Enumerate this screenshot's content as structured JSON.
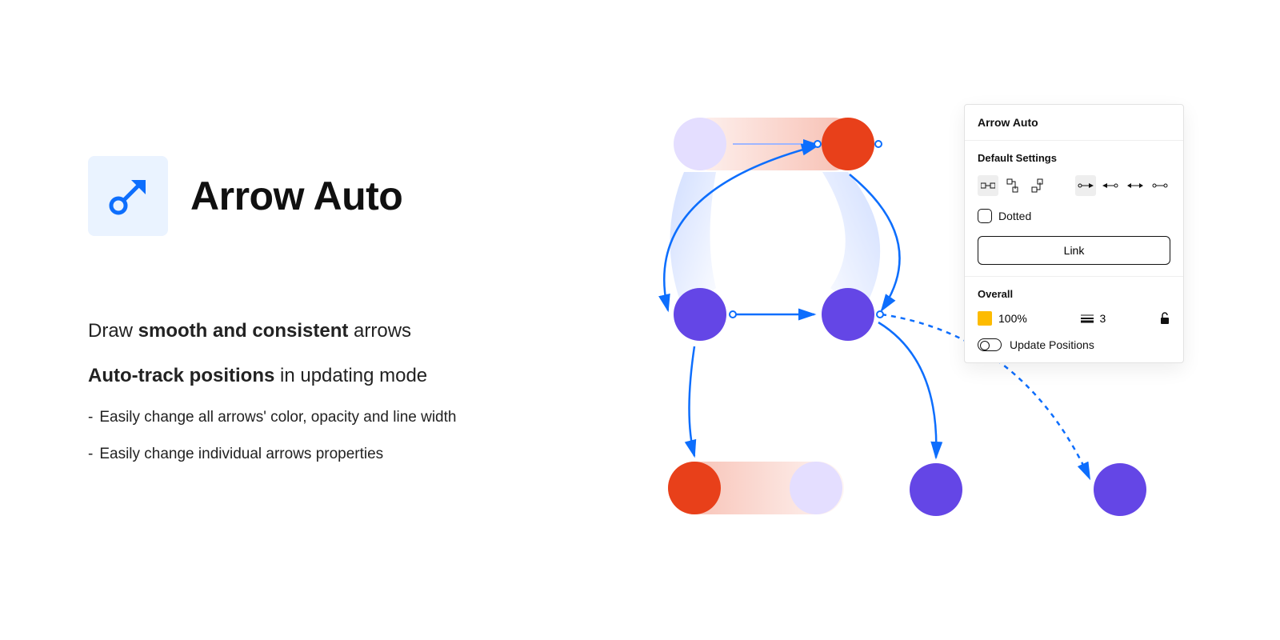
{
  "hero": {
    "title": "Arrow Auto"
  },
  "description": {
    "line1_pre": "Draw ",
    "line1_bold": "smooth and consistent",
    "line1_post": " arrows",
    "line2_bold": "Auto-track positions",
    "line2_post": " in updating mode"
  },
  "bullets": [
    "Easily change all arrows' color, opacity and line width",
    "Easily change individual arrows properties"
  ],
  "panel": {
    "title": "Arrow Auto",
    "defaults_title": "Default Settings",
    "dotted_label": "Dotted",
    "link_label": "Link",
    "overall_title": "Overall",
    "opacity_value": "100%",
    "stroke_value": "3",
    "update_positions_label": "Update Positions"
  },
  "colors": {
    "accent_blue": "#0d6efd",
    "node_purple": "#6446e6",
    "node_red": "#e8401a",
    "node_faded_purple": "#e4deff",
    "swatch": "#fdbb00"
  }
}
